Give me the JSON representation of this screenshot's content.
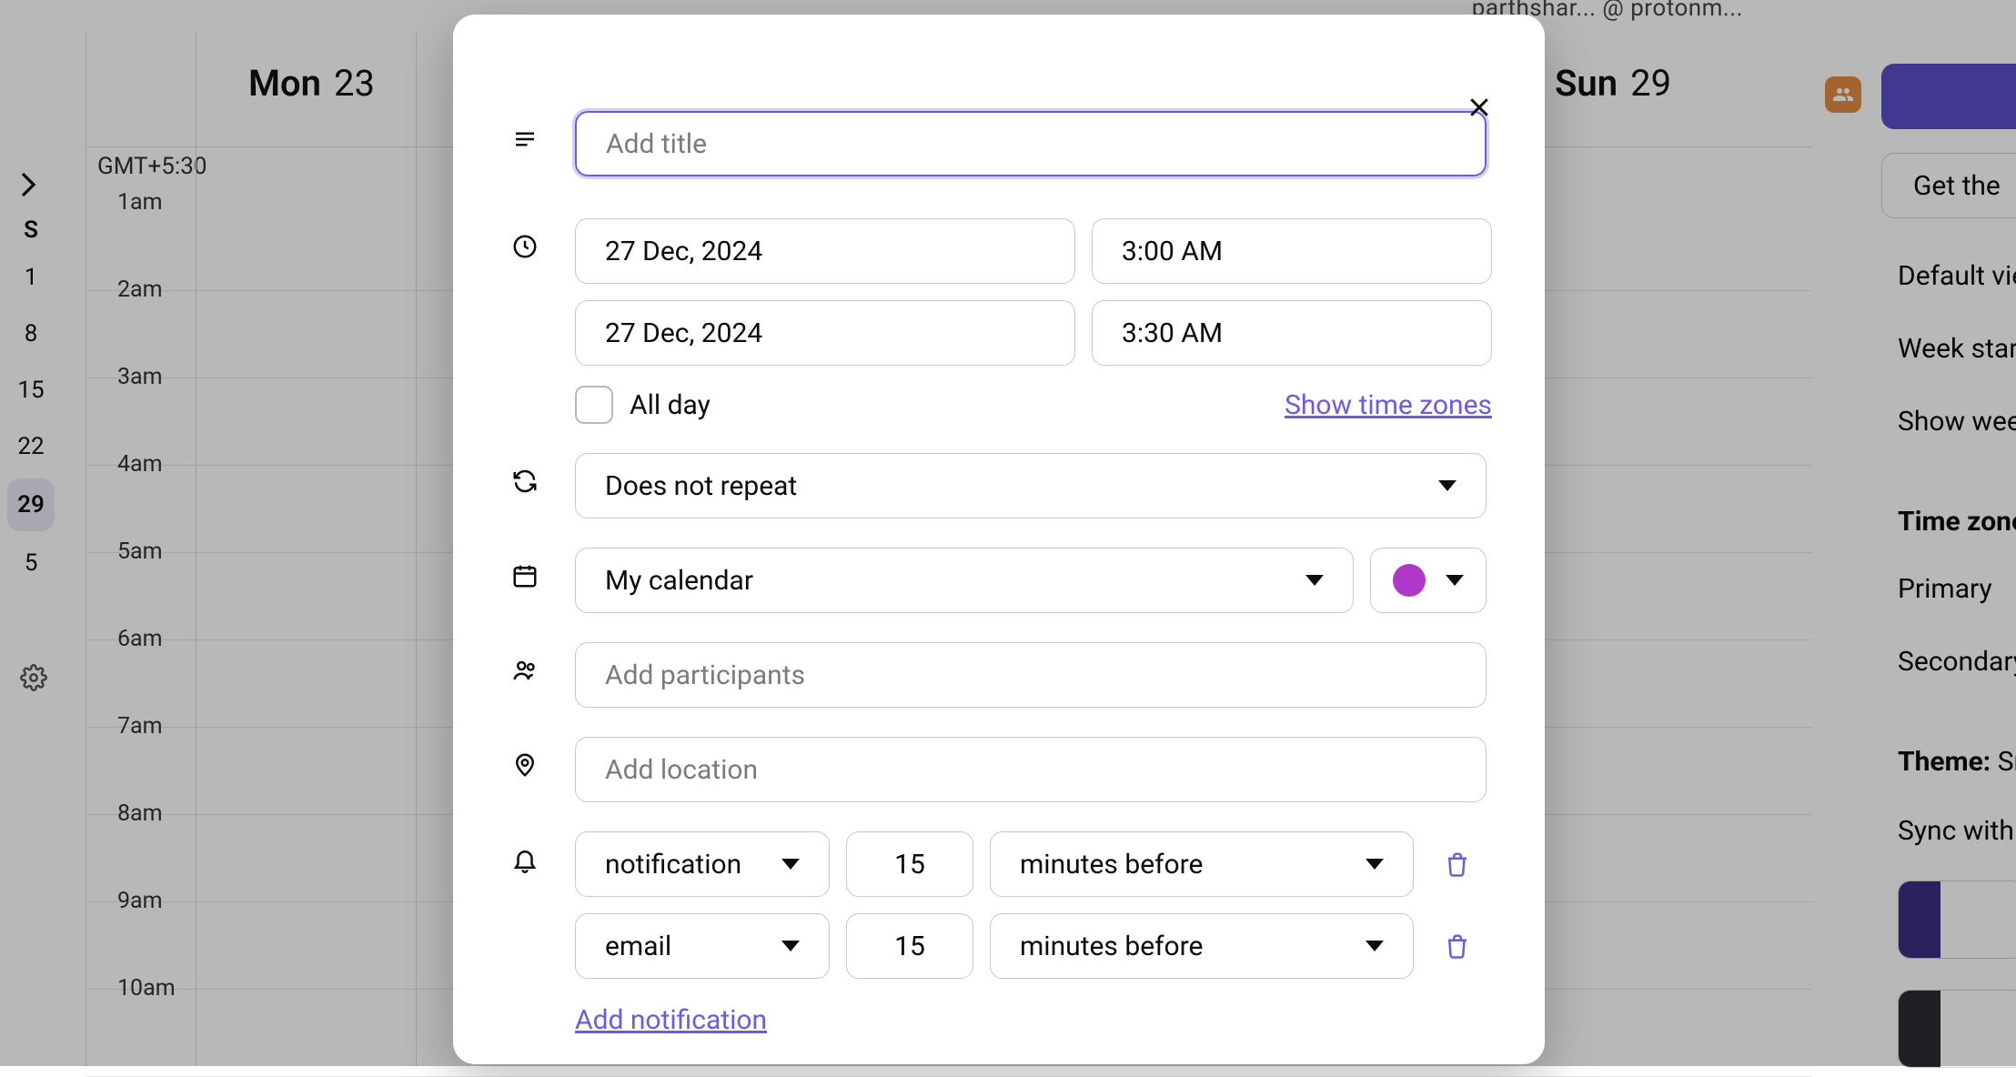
{
  "top_email": "parthshar... @ protonm...",
  "mini_calendar": {
    "weekday_header": "S",
    "days": [
      "1",
      "8",
      "15",
      "22",
      "29",
      "5"
    ],
    "today_index": 4
  },
  "timezone_label": "GMT+5:30",
  "week_header": {
    "mon": {
      "dow": "Mon",
      "num": "23"
    },
    "sun": {
      "dow": "Sun",
      "num": "29"
    }
  },
  "hours": [
    "1am",
    "2am",
    "3am",
    "4am",
    "5am",
    "6am",
    "7am",
    "8am",
    "9am",
    "10am"
  ],
  "right_panel": {
    "get_the": "Get the",
    "default_view": "Default vie",
    "week_start": "Week start",
    "show_week": "Show week",
    "time_zone_hdr": "Time zone",
    "primary": "Primary",
    "secondary": "Secondary t",
    "theme_label": "Theme:",
    "theme_value": "Sno",
    "sync": "Sync with sy"
  },
  "modal": {
    "title_placeholder": "Add title",
    "start_date": "27 Dec, 2024",
    "start_time": "3:00 AM",
    "end_date": "27 Dec, 2024",
    "end_time": "3:30 AM",
    "all_day": "All day",
    "show_tz": "Show time zones",
    "repeat": "Does not repeat",
    "calendar": "My calendar",
    "color": "#b038c9",
    "participants_placeholder": "Add participants",
    "location_placeholder": "Add location",
    "notifications": [
      {
        "type": "notification",
        "amount": "15",
        "unit": "minutes before"
      },
      {
        "type": "email",
        "amount": "15",
        "unit": "minutes before"
      }
    ],
    "add_notification": "Add notification"
  }
}
